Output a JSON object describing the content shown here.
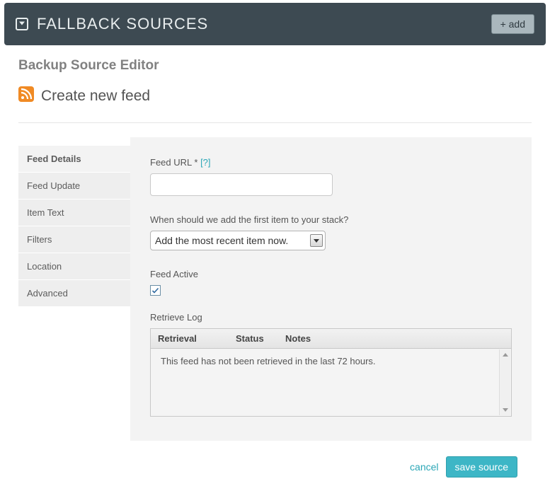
{
  "header": {
    "title": "FALLBACK SOURCES",
    "add_label": "+ add"
  },
  "editor": {
    "title": "Backup Source Editor",
    "subtitle": "Create new feed"
  },
  "tabs": [
    {
      "label": "Feed Details",
      "active": true
    },
    {
      "label": "Feed Update",
      "active": false
    },
    {
      "label": "Item Text",
      "active": false
    },
    {
      "label": "Filters",
      "active": false
    },
    {
      "label": "Location",
      "active": false
    },
    {
      "label": "Advanced",
      "active": false
    }
  ],
  "form": {
    "feed_url_label": "Feed URL *",
    "feed_url_help": "[?]",
    "feed_url_value": "",
    "first_item_label": "When should we add the first item to your stack?",
    "first_item_selected": "Add the most recent item now.",
    "feed_active_label": "Feed Active",
    "feed_active_checked": true,
    "retrieve_log_label": "Retrieve Log",
    "log_headers": {
      "retrieval": "Retrieval",
      "status": "Status",
      "notes": "Notes"
    },
    "log_empty_message": "This feed has not been retrieved in the last 72 hours."
  },
  "footer": {
    "cancel_label": "cancel",
    "save_label": "save source"
  }
}
